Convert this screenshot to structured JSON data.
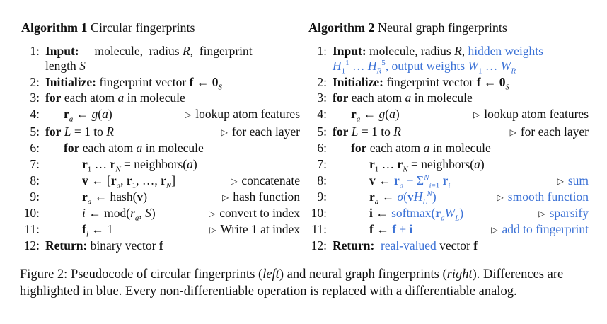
{
  "algorithm1": {
    "label": "Algorithm 1",
    "title": "Circular fingerprints",
    "lines": [
      {
        "num": "1:",
        "kw": "Input:",
        "text": "molecule, radius R, fingerprint",
        "cont": "length S"
      },
      {
        "num": "2:",
        "kw": "Initialize:",
        "text": "fingerprint vector f ← 0_S"
      },
      {
        "num": "3:",
        "kw": "for",
        "text": "each atom a in molecule"
      },
      {
        "num": "4:",
        "text": "r_a ← g(a)",
        "comment": "lookup atom features"
      },
      {
        "num": "5:",
        "kw": "for",
        "text": "L = 1 to R",
        "comment": "for each layer"
      },
      {
        "num": "6:",
        "kw": "for",
        "text": "each atom a in molecule"
      },
      {
        "num": "7:",
        "text": "r_1 … r_N = neighbors(a)"
      },
      {
        "num": "8:",
        "text": "v ← [r_a, r_1, …, r_N]",
        "comment": "concatenate"
      },
      {
        "num": "9:",
        "text": "r_a ← hash(v)",
        "comment": "hash function"
      },
      {
        "num": "10:",
        "text": "i ← mod(r_a, S)",
        "comment": "convert to index"
      },
      {
        "num": "11:",
        "text": "f_i ← 1",
        "comment": "Write 1 at index"
      },
      {
        "num": "12:",
        "kw": "Return:",
        "text": "binary vector f"
      }
    ]
  },
  "algorithm2": {
    "label": "Algorithm 2",
    "title": "Neural graph fingerprints",
    "lines": [
      {
        "num": "1:",
        "kw": "Input:",
        "text": "molecule, radius R,",
        "blue": "hidden weights",
        "cont_blue": "H_1^1 … H_R^5, output weights W_1 … W_R"
      },
      {
        "num": "2:",
        "kw": "Initialize:",
        "text": "fingerprint vector f ← 0_S"
      },
      {
        "num": "3:",
        "kw": "for",
        "text": "each atom a in molecule"
      },
      {
        "num": "4:",
        "text": "r_a ← g(a)",
        "comment": "lookup atom features"
      },
      {
        "num": "5:",
        "kw": "for",
        "text": "L = 1 to R",
        "comment": "for each layer"
      },
      {
        "num": "6:",
        "kw": "for",
        "text": "each atom a in molecule"
      },
      {
        "num": "7:",
        "text": "r_1 … r_N = neighbors(a)"
      },
      {
        "num": "8:",
        "text": "v ← r_a + Σ_{i=1}^N r_i",
        "comment": "sum"
      },
      {
        "num": "9:",
        "text": "r_a ← σ(v H_L^N)",
        "comment": "smooth function"
      },
      {
        "num": "10:",
        "text": "i ← softmax(r_a W_L)",
        "comment": "sparsify"
      },
      {
        "num": "11:",
        "text": "f ← f + i",
        "comment": "add to fingerprint"
      },
      {
        "num": "12:",
        "kw": "Return:",
        "blue": "real-valued",
        "text": "vector f"
      }
    ]
  },
  "caption": {
    "lead": "Figure 2: Pseudocode of circular fingerprints (",
    "left": "left",
    "mid": ") and neural graph fingerprints (",
    "right": "right",
    "tail": "). Differences are highlighted in blue. Every non-differentiable operation is replaced with a differentiable analog."
  },
  "colors": {
    "highlight": "#3c72d6",
    "text": "#111111"
  }
}
